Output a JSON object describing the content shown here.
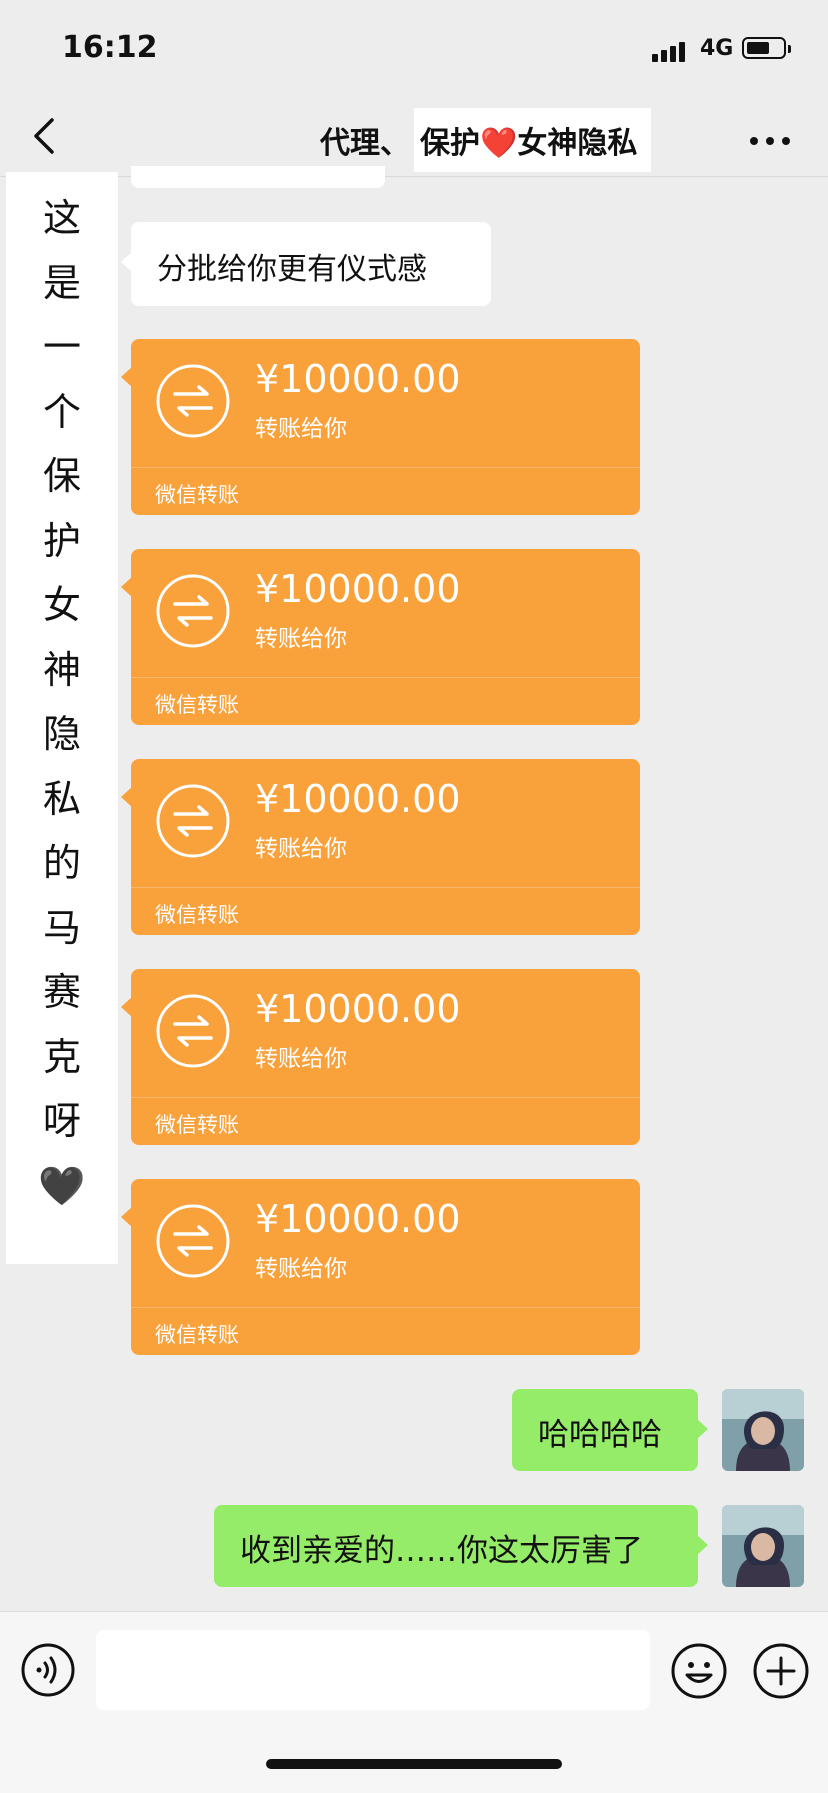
{
  "status_bar": {
    "time": "16:12",
    "network": "4G"
  },
  "nav": {
    "title_prefix": "代理、",
    "title_highlight": "保护❤️女神隐私"
  },
  "messages": {
    "incoming_text": "分批给你更有仪式感",
    "transfers": [
      {
        "amount": "¥10000.00",
        "subtitle": "转账给你",
        "footer": "微信转账"
      },
      {
        "amount": "¥10000.00",
        "subtitle": "转账给你",
        "footer": "微信转账"
      },
      {
        "amount": "¥10000.00",
        "subtitle": "转账给你",
        "footer": "微信转账"
      },
      {
        "amount": "¥10000.00",
        "subtitle": "转账给你",
        "footer": "微信转账"
      },
      {
        "amount": "¥10000.00",
        "subtitle": "转账给你",
        "footer": "微信转账"
      }
    ],
    "outgoing": [
      {
        "text": "哈哈哈哈"
      },
      {
        "text": "收到亲爱的……你这太厉害了"
      }
    ]
  },
  "vertical_caption": {
    "chars": [
      "这",
      "是",
      "一",
      "个",
      "保",
      "护",
      "女",
      "神",
      "隐",
      "私",
      "的",
      "马",
      "赛",
      "克",
      "呀",
      "🖤"
    ]
  },
  "colors": {
    "transfer_orange": "#f9a13b",
    "outgoing_green": "#95ec69",
    "chat_background": "#ededed"
  },
  "icons": [
    "back-chevron-icon",
    "more-dots-icon",
    "transfer-arrows-icon",
    "voice-icon",
    "emoji-icon",
    "plus-icon"
  ]
}
